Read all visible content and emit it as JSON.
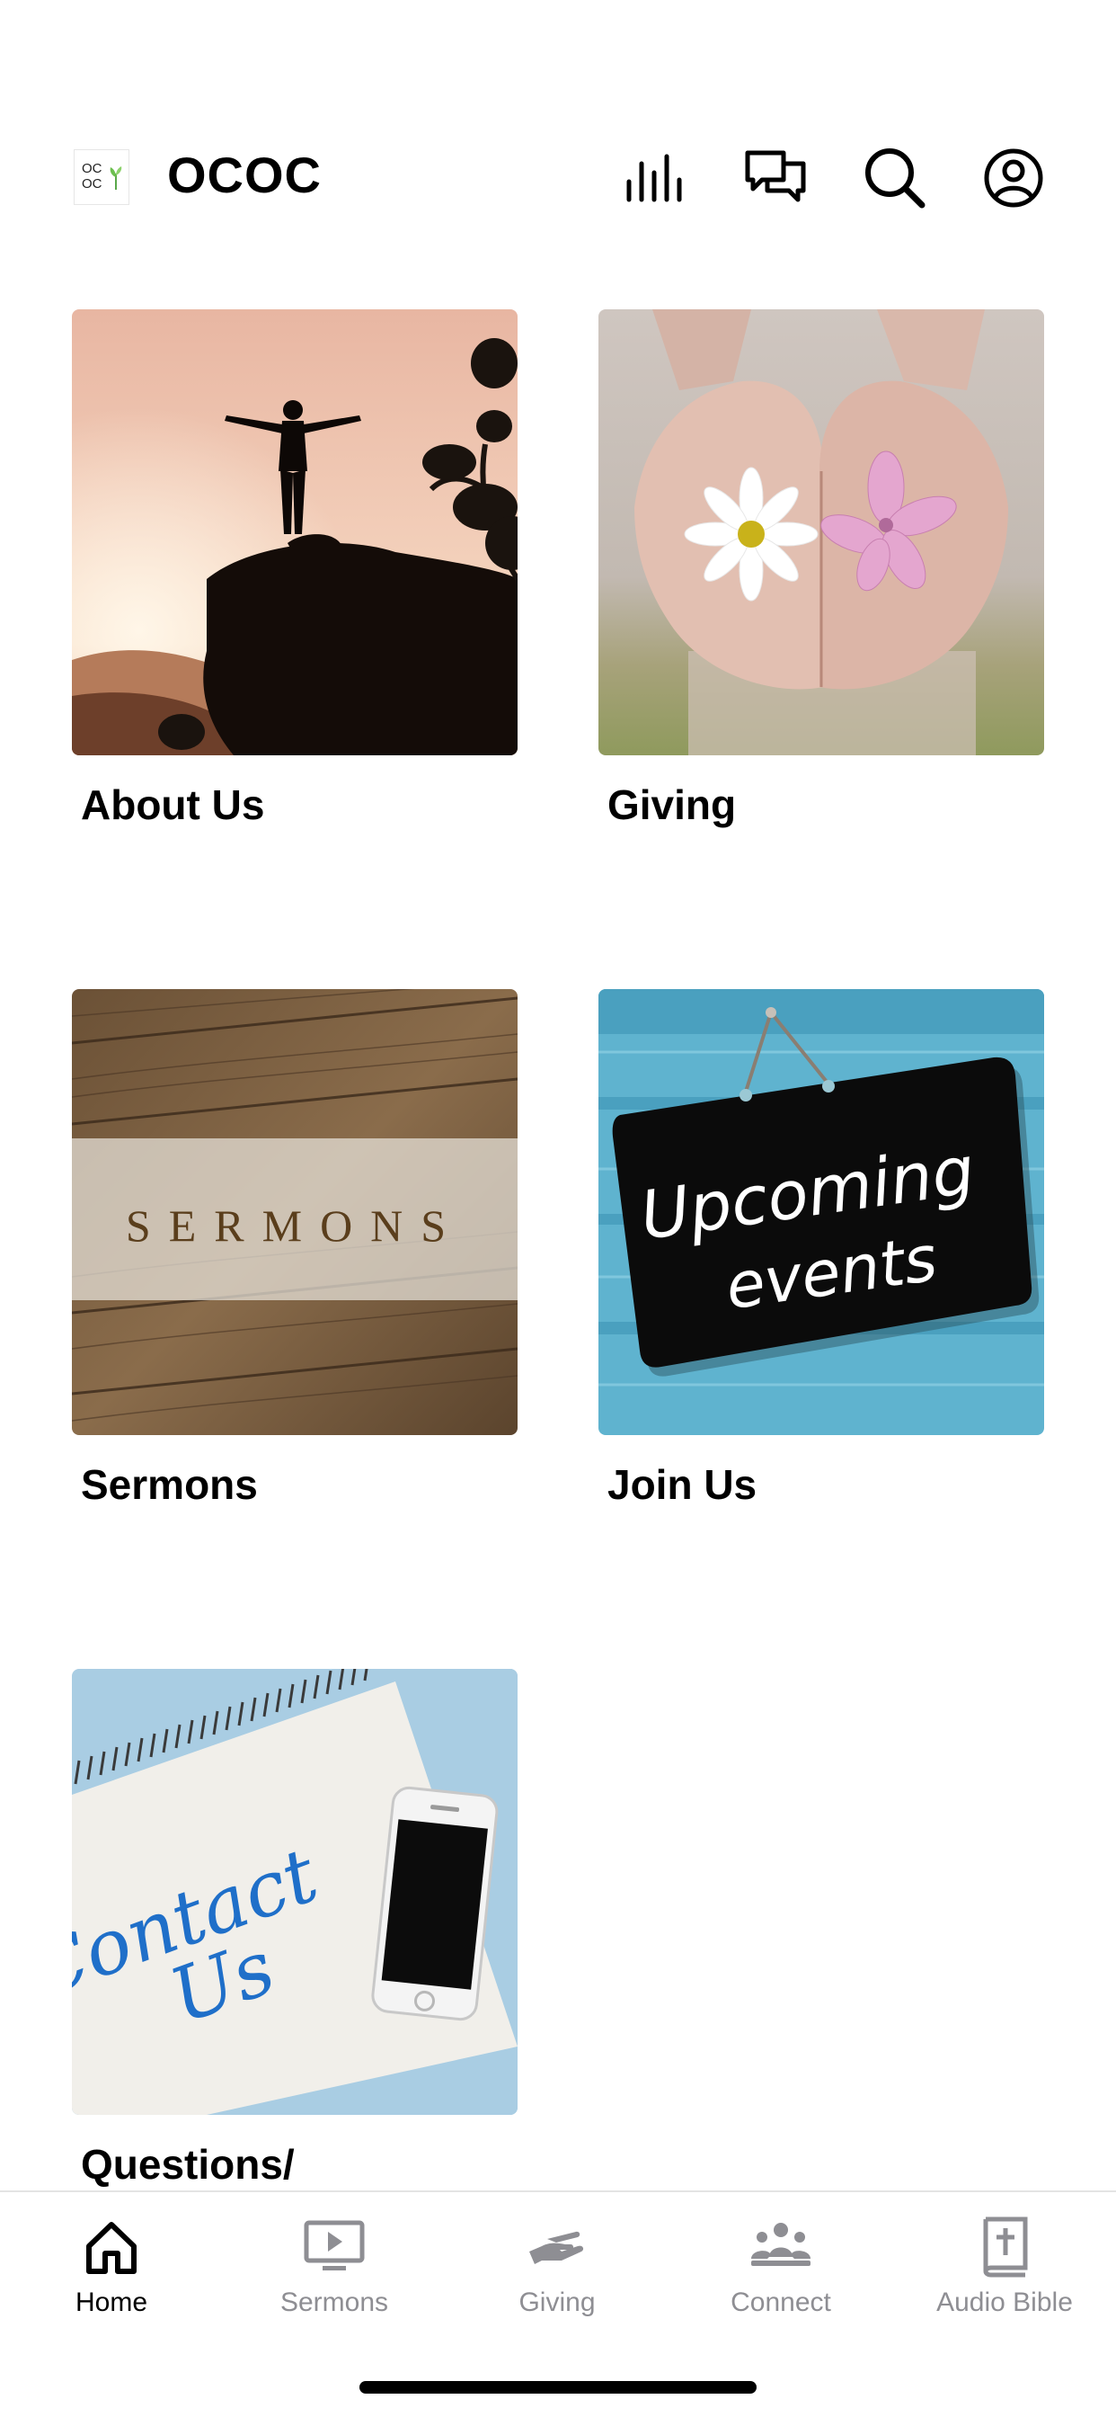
{
  "header": {
    "logo_line1": "OC",
    "logo_line2": "OC",
    "title": "OCOC",
    "icons": [
      "audio-bars-icon",
      "chat-icon",
      "search-icon",
      "account-icon"
    ]
  },
  "tiles": [
    {
      "label": "About Us",
      "image": "person-on-rock-sunset"
    },
    {
      "label": "Giving",
      "image": "hands-holding-flowers"
    },
    {
      "label": "Sermons",
      "image": "wood-sermons-banner",
      "image_text": "SERMONS"
    },
    {
      "label": "Join Us",
      "image": "upcoming-events-sign",
      "image_text_line1": "Upcoming",
      "image_text_line2": "events"
    },
    {
      "label": "Questions/",
      "image": "contact-us-notebook",
      "image_text_line1": "Contact",
      "image_text_line2": "Us"
    }
  ],
  "tabbar": {
    "active": "Home",
    "tabs": [
      {
        "label": "Home",
        "icon": "home-icon"
      },
      {
        "label": "Sermons",
        "icon": "video-icon"
      },
      {
        "label": "Giving",
        "icon": "giving-hand-icon"
      },
      {
        "label": "Connect",
        "icon": "people-icon"
      },
      {
        "label": "Audio Bible",
        "icon": "bible-icon"
      }
    ]
  },
  "colors": {
    "active_tab": "#000000",
    "inactive_tab": "#8e8e93",
    "background": "#ffffff"
  }
}
